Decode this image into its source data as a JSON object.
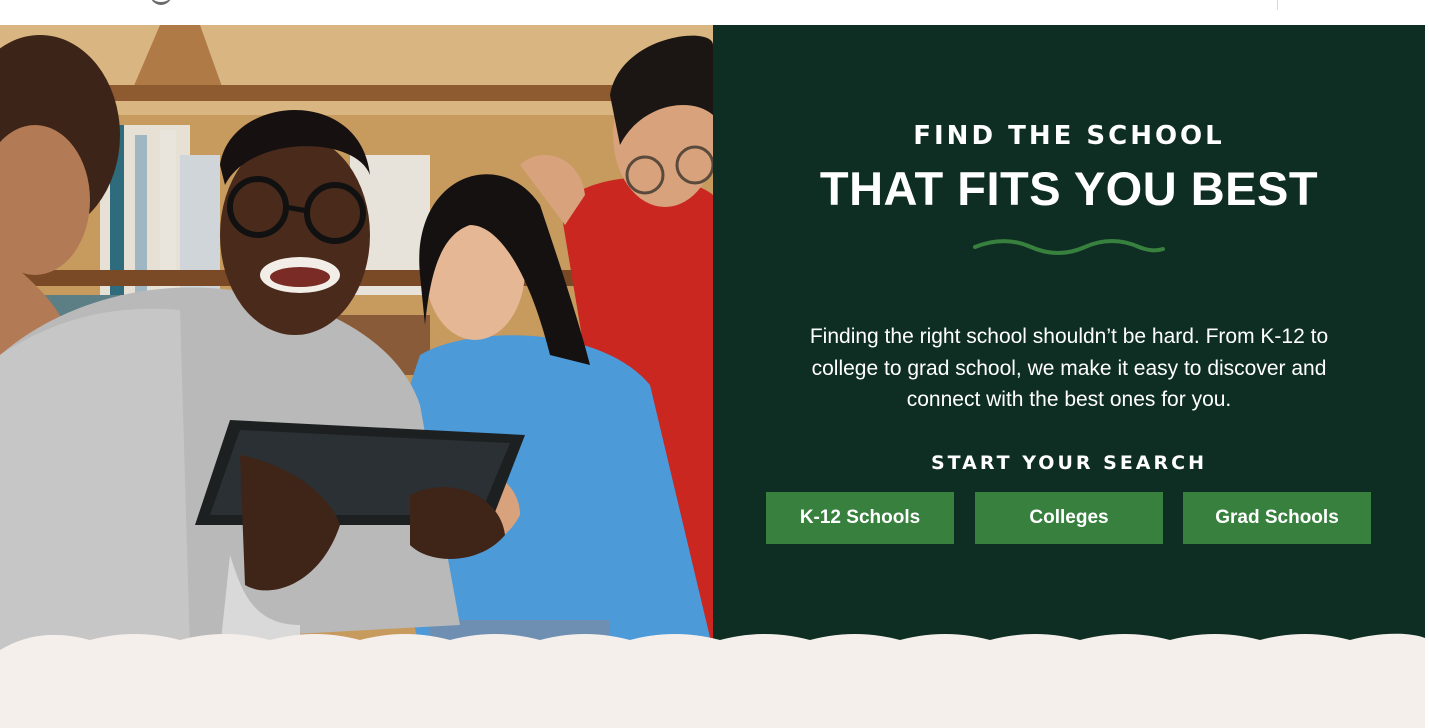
{
  "hero": {
    "kicker": "FIND THE SCHOOL",
    "headline": "THAT FITS YOU BEST",
    "description": "Finding the right school shouldn’t be hard. From K-12 to college to grad school, we make it easy to discover and connect with the best ones for you.",
    "search_label": "START YOUR SEARCH",
    "buttons": {
      "k12": "K-12 Schools",
      "colleges": "Colleges",
      "grad": "Grad Schools"
    }
  },
  "colors": {
    "panel": "#0f2e23",
    "accent": "#37803d",
    "lower_bg": "#f5efec"
  }
}
